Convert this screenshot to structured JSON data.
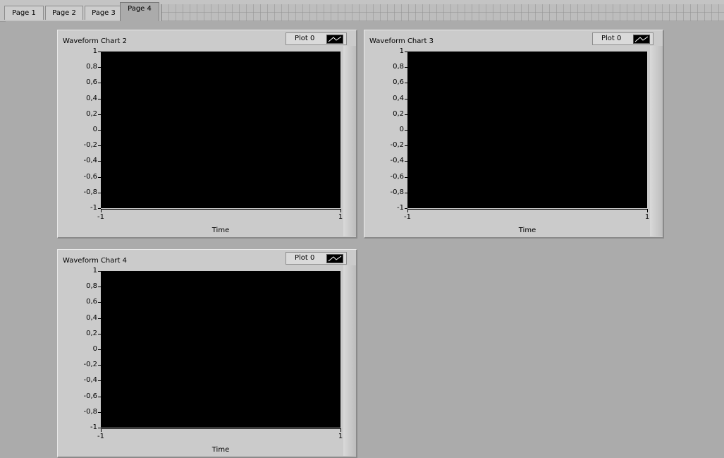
{
  "tabs": [
    {
      "label": "Page 1",
      "active": false
    },
    {
      "label": "Page 2",
      "active": false
    },
    {
      "label": "Page 3",
      "active": false
    },
    {
      "label": "Page 4",
      "active": true
    }
  ],
  "charts": [
    {
      "title": "Waveform Chart 2",
      "legend_label": "Plot 0",
      "x_axis_title": "Time",
      "y_ticks": [
        "1",
        "0,8",
        "0,6",
        "0,4",
        "0,2",
        "0",
        "-0,2",
        "-0,4",
        "-0,6",
        "-0,8",
        "-1"
      ],
      "x_ticks": [
        "-1",
        "1"
      ]
    },
    {
      "title": "Waveform Chart 3",
      "legend_label": "Plot 0",
      "x_axis_title": "Time",
      "y_ticks": [
        "1",
        "0,8",
        "0,6",
        "0,4",
        "0,2",
        "0",
        "-0,2",
        "-0,4",
        "-0,6",
        "-0,8",
        "-1"
      ],
      "x_ticks": [
        "-1",
        "1"
      ]
    },
    {
      "title": "Waveform Chart 4",
      "legend_label": "Plot 0",
      "x_axis_title": "Time",
      "y_ticks": [
        "1",
        "0,8",
        "0,6",
        "0,4",
        "0,2",
        "0",
        "-0,2",
        "-0,4",
        "-0,6",
        "-0,8",
        "-1"
      ],
      "x_ticks": [
        "-1",
        "1"
      ]
    }
  ],
  "chart_data": [
    {
      "type": "line",
      "title": "Waveform Chart 2",
      "xlabel": "Time",
      "ylabel": "",
      "xlim": [
        -1,
        1
      ],
      "ylim": [
        -1,
        1
      ],
      "series": [
        {
          "name": "Plot 0",
          "x": [],
          "values": []
        }
      ]
    },
    {
      "type": "line",
      "title": "Waveform Chart 3",
      "xlabel": "Time",
      "ylabel": "",
      "xlim": [
        -1,
        1
      ],
      "ylim": [
        -1,
        1
      ],
      "series": [
        {
          "name": "Plot 0",
          "x": [],
          "values": []
        }
      ]
    },
    {
      "type": "line",
      "title": "Waveform Chart 4",
      "xlabel": "Time",
      "ylabel": "",
      "xlim": [
        -1,
        1
      ],
      "ylim": [
        -1,
        1
      ],
      "series": [
        {
          "name": "Plot 0",
          "x": [],
          "values": []
        }
      ]
    }
  ],
  "colors": {
    "plot_background": "#000000",
    "panel_background": "#ababab"
  }
}
